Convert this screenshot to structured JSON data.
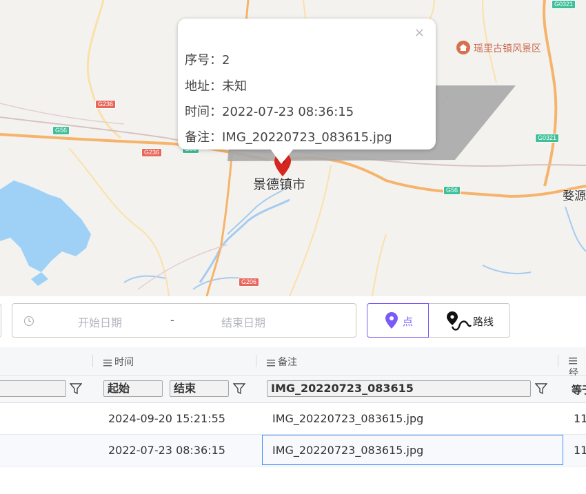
{
  "map": {
    "city_label": "景德镇市",
    "town_label": "婺源",
    "poi_label": "瑶里古镇风景区",
    "shields": {
      "g236_a": "G236",
      "g236_b": "G236",
      "g56_a": "G56",
      "g56_b": "G56",
      "g56_c": "G56",
      "g206": "G206",
      "g0321_a": "G0321",
      "g0321_b": "G0321"
    }
  },
  "popup": {
    "close": "×",
    "rows": [
      "序号：2",
      "地址：未知",
      "时间：2022-07-23 08:36:15",
      "备注：IMG_20220723_083615.jpg"
    ]
  },
  "toolbar": {
    "date_start_placeholder": "开始日期",
    "date_separator": "-",
    "date_end_placeholder": "结束日期",
    "mode_point": "点",
    "mode_route": "路线",
    "accent": "#7a5af8"
  },
  "grid": {
    "headers": {
      "time": "时间",
      "remark": "备注",
      "last": "经"
    },
    "filters": {
      "time_start": "起始",
      "time_end": "结束",
      "remark": "IMG_20220723_083615",
      "last": "等于"
    },
    "rows": [
      {
        "time": "2024-09-20 15:21:55",
        "remark": "IMG_20220723_083615.jpg",
        "last": "11"
      },
      {
        "time": "2022-07-23 08:36:15",
        "remark": "IMG_20220723_083615.jpg",
        "last": "11"
      }
    ]
  }
}
